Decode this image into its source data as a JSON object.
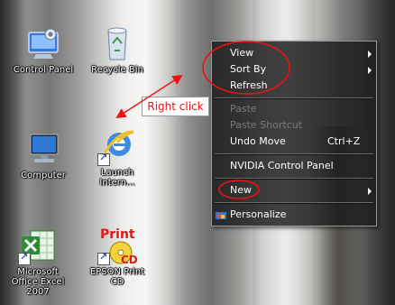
{
  "desktop": {
    "icons": [
      {
        "name": "control-panel",
        "label": "Control Panel",
        "icon": "control-panel-icon"
      },
      {
        "name": "recycle-bin",
        "label": "Recycle Bin",
        "icon": "recycle-bin-icon"
      },
      {
        "name": "computer",
        "label": "Computer",
        "icon": "computer-icon"
      },
      {
        "name": "launch-internet",
        "label": "Launch Intern...",
        "icon": "internet-explorer-icon"
      },
      {
        "name": "excel-2007",
        "label": "Microsoft Office Excel 2007",
        "icon": "excel-icon"
      },
      {
        "name": "epson-print-cd",
        "label": "EPSON Print CD",
        "icon": "epson-print-cd-icon"
      }
    ],
    "epson_icon_text": {
      "line1": "Print",
      "line2": "CD"
    }
  },
  "context_menu": {
    "items": [
      {
        "label": "View",
        "has_submenu": true,
        "disabled": false
      },
      {
        "label": "Sort By",
        "has_submenu": true,
        "disabled": false
      },
      {
        "label": "Refresh",
        "has_submenu": false,
        "disabled": false
      },
      {
        "label": "Paste",
        "has_submenu": false,
        "disabled": true
      },
      {
        "label": "Paste Shortcut",
        "has_submenu": false,
        "disabled": true
      },
      {
        "label": "Undo Move",
        "shortcut": "Ctrl+Z",
        "has_submenu": false,
        "disabled": false
      },
      {
        "label": "NVIDIA Control Panel",
        "has_submenu": false,
        "disabled": false
      },
      {
        "label": "New",
        "has_submenu": true,
        "disabled": false
      },
      {
        "label": "Personalize",
        "has_submenu": false,
        "disabled": false,
        "icon": "personalize-icon"
      }
    ]
  },
  "annotation": {
    "callout": "Right click",
    "color": "#ee1111"
  },
  "colors": {
    "menu_background": "#1a1a1a",
    "menu_text": "#ffffff",
    "menu_disabled_text": "#7a7a7a",
    "annotation_red": "#ee1111"
  }
}
